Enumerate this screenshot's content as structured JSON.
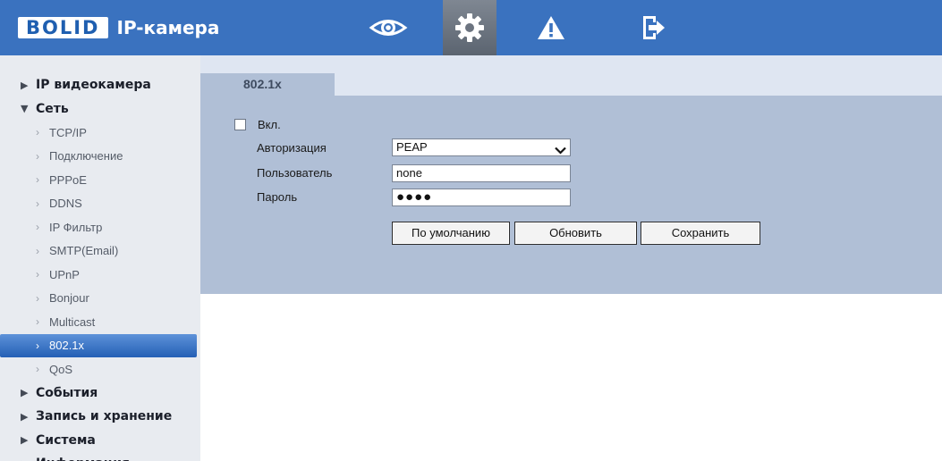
{
  "header": {
    "logo_brand": "BOLID",
    "logo_product": "IP-камера",
    "nav": [
      {
        "icon": "eye-icon",
        "name": "live-view"
      },
      {
        "icon": "gear-icon",
        "name": "settings",
        "active": true
      },
      {
        "icon": "warning-icon",
        "name": "alarm"
      },
      {
        "icon": "exit-icon",
        "name": "logout"
      }
    ]
  },
  "sidebar": {
    "items": [
      {
        "label": "IP видеокамера",
        "level": "top",
        "expanded": false
      },
      {
        "label": "Сеть",
        "level": "top",
        "expanded": true
      },
      {
        "label": "TCP/IP",
        "level": "sub"
      },
      {
        "label": "Подключение",
        "level": "sub"
      },
      {
        "label": "PPPoE",
        "level": "sub"
      },
      {
        "label": "DDNS",
        "level": "sub"
      },
      {
        "label": "IP Фильтр",
        "level": "sub"
      },
      {
        "label": "SMTP(Email)",
        "level": "sub"
      },
      {
        "label": "UPnP",
        "level": "sub"
      },
      {
        "label": "Bonjour",
        "level": "sub"
      },
      {
        "label": "Multicast",
        "level": "sub"
      },
      {
        "label": "802.1x",
        "level": "sub",
        "active": true
      },
      {
        "label": "QoS",
        "level": "sub"
      },
      {
        "label": "События",
        "level": "top",
        "expanded": false
      },
      {
        "label": "Запись и хранение",
        "level": "top",
        "expanded": false
      },
      {
        "label": "Система",
        "level": "top",
        "expanded": false
      },
      {
        "label": "Информация",
        "level": "top",
        "expanded": false
      }
    ]
  },
  "tab": {
    "label": "802.1x"
  },
  "form": {
    "enable_label": "Вкл.",
    "enable_checked": false,
    "auth_label": "Авторизация",
    "auth_value": "PEAP",
    "user_label": "Пользователь",
    "user_value": "none",
    "password_label": "Пароль",
    "password_mask": "●●●●"
  },
  "buttons": {
    "default_label": "По умолчанию",
    "refresh_label": "Обновить",
    "save_label": "Сохранить"
  },
  "colors": {
    "header_bg": "#3a72bf",
    "sidebar_bg": "#e8ebf0",
    "panel_bg": "#b0bfd6",
    "active_item": "#2f6cc0"
  }
}
